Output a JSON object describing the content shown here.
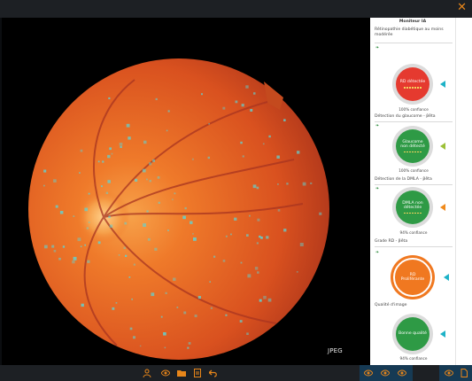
{
  "window": {
    "close_glyph": "✕"
  },
  "viewer": {
    "format_label": "JPEG"
  },
  "panel": {
    "monitor_label": "Moniteur IA",
    "sections": [
      {
        "title": "Rétinopathie diabétique au moins modérée",
        "result": "RD détectée",
        "confidence": "100% confiance",
        "status_color": "#e53a2f",
        "arrow_color": "#1db2c7"
      },
      {
        "title": "Détection du glaucome - βêta",
        "result": "Glaucome non détecté",
        "confidence": "100% confiance",
        "status_color": "#2e9a45",
        "arrow_color": "#9cc037"
      },
      {
        "title": "Détection de la DMLA - βêta",
        "result": "DMLA non détectée",
        "confidence": "94% confiance",
        "status_color": "#2e9a45",
        "arrow_color": "#f08a1c"
      },
      {
        "title": "Grade RD - βêta",
        "result": "RD Proliférante",
        "confidence": "",
        "status_color": "#f07820",
        "arrow_color": "#1db2c7"
      },
      {
        "title": "Qualité d'image",
        "result": "Bonne qualité",
        "confidence": "94% confiance",
        "status_color": "#2e9a45",
        "arrow_color": "#1db2c7"
      }
    ]
  },
  "toolbar": {
    "left_icons": [
      "person-icon",
      "eye-icon",
      "folder-icon",
      "document-icon",
      "undo-icon"
    ],
    "right_icons": [
      "view-eye-icon-1",
      "view-eye-icon-2",
      "view-eye-icon-3",
      "view-eye-icon-4",
      "export-icon"
    ]
  },
  "colors": {
    "accent": "#e8861a",
    "toolbar_selected": "#163a54",
    "highlight": "#5fd4d4"
  }
}
